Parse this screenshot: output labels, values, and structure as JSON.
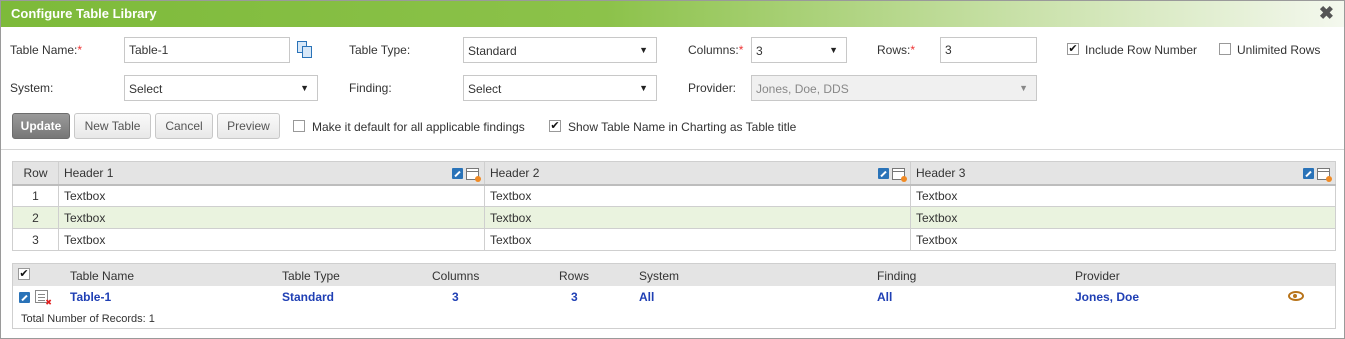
{
  "window": {
    "title": "Configure Table Library",
    "close_glyph": "✖"
  },
  "form": {
    "table_name": {
      "label": "Table Name:",
      "required": "*",
      "value": "Table-1"
    },
    "table_type": {
      "label": "Table Type:",
      "value": "Standard"
    },
    "columns": {
      "label": "Columns:",
      "required": "*",
      "value": "3"
    },
    "rows": {
      "label": "Rows:",
      "required": "*",
      "value": "3"
    },
    "include_row_number": {
      "label": "Include Row Number",
      "checked": true
    },
    "unlimited_rows": {
      "label": "Unlimited Rows",
      "checked": false
    },
    "system": {
      "label": "System:",
      "value": "Select"
    },
    "finding": {
      "label": "Finding:",
      "value": "Select"
    },
    "provider": {
      "label": "Provider:",
      "value": "Jones, Doe, DDS",
      "disabled": true
    },
    "make_default": {
      "label": "Make it default for all applicable findings",
      "checked": false
    },
    "show_table_name": {
      "label": "Show Table Name in Charting as Table title",
      "checked": true
    }
  },
  "buttons": {
    "update": "Update",
    "new_table": "New Table",
    "cancel": "Cancel",
    "preview": "Preview"
  },
  "preview_grid": {
    "row_header": "Row",
    "headers": [
      "Header 1",
      "Header 2",
      "Header 3"
    ],
    "rows": [
      {
        "num": "1",
        "cells": [
          "Textbox",
          "Textbox",
          "Textbox"
        ]
      },
      {
        "num": "2",
        "cells": [
          "Textbox",
          "Textbox",
          "Textbox"
        ]
      },
      {
        "num": "3",
        "cells": [
          "Textbox",
          "Textbox",
          "Textbox"
        ]
      }
    ]
  },
  "records": {
    "columns": [
      "Table Name",
      "Table Type",
      "Columns",
      "Rows",
      "System",
      "Finding",
      "Provider"
    ],
    "items": [
      {
        "table_name": "Table-1",
        "table_type": "Standard",
        "columns": "3",
        "rows": "3",
        "system": "All",
        "finding": "All",
        "provider": "Jones, Doe"
      }
    ],
    "footer": "Total Number of Records: 1"
  },
  "colors": {
    "title_green": "#7dba3a",
    "link_blue": "#1f3fb4",
    "alt_row": "#eaf3df",
    "required": "#e33"
  }
}
